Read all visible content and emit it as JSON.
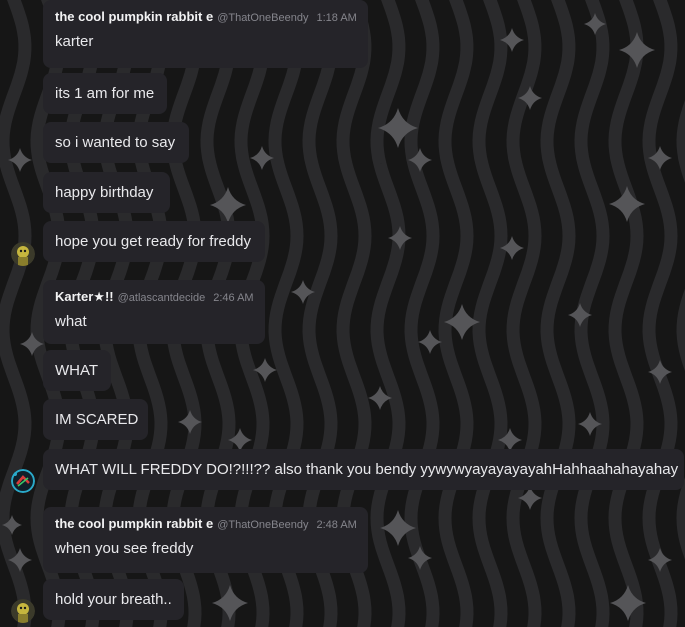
{
  "groups": [
    {
      "author": "the cool pumpkin rabbit e",
      "handle": "@ThatOneBeendy",
      "time": "1:18 AM",
      "avatar_icon": "pumpkin-rabbit-avatar",
      "messages": [
        "karter",
        "its 1 am for me",
        "so i wanted to say",
        "happy birthday",
        "hope you get ready for freddy"
      ]
    },
    {
      "author": "Karter★!!",
      "handle": "@atlascantdecide",
      "time": "2:46 AM",
      "avatar_icon": "atlas-avatar",
      "messages": [
        "what",
        "WHAT",
        "IM SCARED",
        "WHAT WILL FREDDY DO!?!!!?? also thank you bendy yywywyayayayayahHahhaahahayahay"
      ]
    },
    {
      "author": "the cool pumpkin rabbit e",
      "handle": "@ThatOneBeendy",
      "time": "2:48 AM",
      "avatar_icon": "pumpkin-rabbit-avatar",
      "messages": [
        "when you see freddy",
        "hold your breath.."
      ]
    }
  ],
  "colors": {
    "background": "#161616",
    "wave": "#2a2a2c",
    "sparkle": "#555558",
    "bubble": "#252429",
    "text": "#e9e9ec",
    "muted": "#85858c"
  }
}
